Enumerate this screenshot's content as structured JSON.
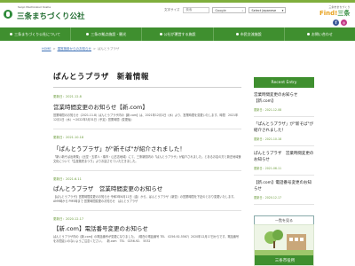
{
  "header": {
    "org_subtitle": "Sanjo Machizukuri Kosha",
    "org_name": "三条まちづくり公社",
    "utility_links": [
      "文字サイズ",
      "Select"
    ],
    "search_placeholder": "検索",
    "google_label": "Google",
    "language_select": "Select Japanese",
    "find_subtitle": "三条市まちづくり",
    "find_title": "Find!",
    "find_title_suffix": "三条",
    "social": [
      {
        "icon": "facebook-icon",
        "label": "f"
      },
      {
        "icon": "instagram-icon",
        "label": "◎"
      }
    ]
  },
  "nav": {
    "items": [
      "三条まちづくり公社について",
      "三条の拠点施設・観光",
      "公社が運営する施設",
      "市民交流施設",
      "お問い合わせ"
    ]
  },
  "breadcrumb": {
    "home": "HOME",
    "parent": "運営施設からのお知らせ",
    "current": "ぱんとうプラザ"
  },
  "main": {
    "title": "ぱんとうプラザ　新着情報",
    "posts": [
      {
        "date": "更新日：2021.12.8",
        "title": "営業時間変更のお知らせ【新.com】",
        "body": "営業時間のお知らせ（2021.11.8）ぱんとうプラザ内の【新.com】は、2021年12月1日（水）より、営業時間を変更いたします。時間　2021年12月1日（水）～2022年3月31日（予定）営業時間（変更後）"
      },
      {
        "date": "更新日：2021.10.18",
        "title": "「ぱんとうプラザ」が\"新そば\"が紹介されました！",
        "body": "「新い新そば出荷祭」（比堂・五重人・椿市・山古志地域）にて、三条新聞内の「ぱんとうプラザ」が紹介されました。とあるお店の方と新庄地域食文化について「生産販売まつり」よりお話させていただきました。"
      },
      {
        "date": "更新日：2021.6.11",
        "title": "ぱんとうプラザ　営業時間変更のお知らせ",
        "body": "【ぱんとうプラザ】営業時間変更のお知らせ 令和3年6月11日（金）から、ぱんとうプラザ（新堂）の営業時間を下記のとおり変更いたします。AM9時から PM5時まで 営業時間変更のお知らせ　ぱんとうプラザ"
      },
      {
        "date": "更新日：2020.12.17",
        "title": "【新.com】電話番号変更のお知らせ",
        "body": "ぱんとうプラザ内の【新.com】の電話番号が変更になりました。（現在の電話番号 TEL　0256-92-5567）2020年12月17日からです。電話番号をお間違いのないようご注意ください。　新.com　TEL　0256-92-　5532"
      }
    ]
  },
  "sidebar": {
    "heading": "Recent Entry",
    "entries": [
      {
        "title": "営業時間変更のお知らせ【新.com】",
        "date": "更新日：2021.12.08"
      },
      {
        "title": "「ぱんとうプラザ」が\"新そば\"が紹介されました！",
        "date": "更新日：2021.10.18"
      },
      {
        "title": "ぱんとうプラザ　営業時間変更のお知らせ",
        "date": "更新日：2021.06.11"
      },
      {
        "title": "【新.com】電話番号変更のお知らせ",
        "date": "更新日：2020.12.17"
      }
    ],
    "all_button": "一覧を見る",
    "banner_label": "三条市役所"
  }
}
